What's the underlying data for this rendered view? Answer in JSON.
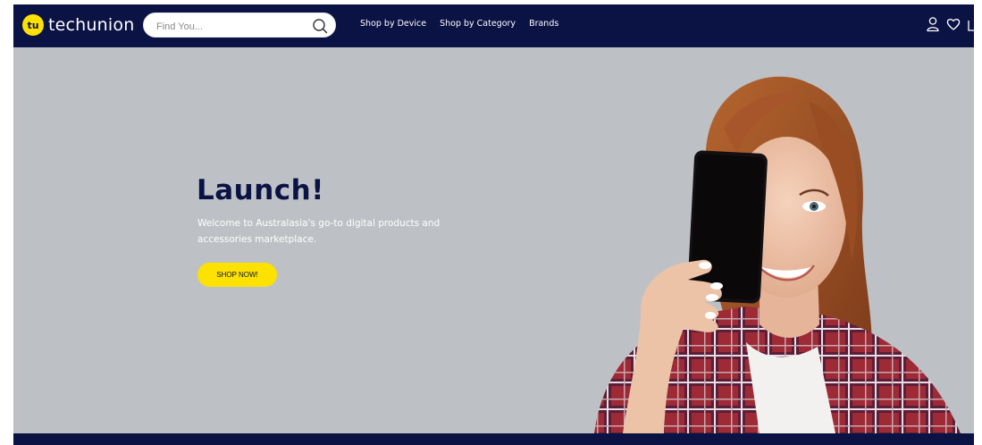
{
  "brand": {
    "badge": "tu",
    "name": "techunion",
    "badge_color": "#fde100",
    "navy_color": "#0b1244"
  },
  "search": {
    "placeholder": "Find You...",
    "value": "",
    "icon": "search-icon"
  },
  "nav": {
    "links": [
      {
        "label": "Shop by Device"
      },
      {
        "label": "Shop by Category"
      },
      {
        "label": "Brands"
      }
    ],
    "icons": [
      "account-icon",
      "wishlist-heart-icon",
      "cart-icon"
    ]
  },
  "hero": {
    "title": "Launch!",
    "text": "Welcome to Australasia's go-to digital products and accessories marketplace.",
    "cta_label": "SHOP NOW!",
    "background": "#bdc1c5",
    "image": "woman-holding-smartphone-photo"
  }
}
